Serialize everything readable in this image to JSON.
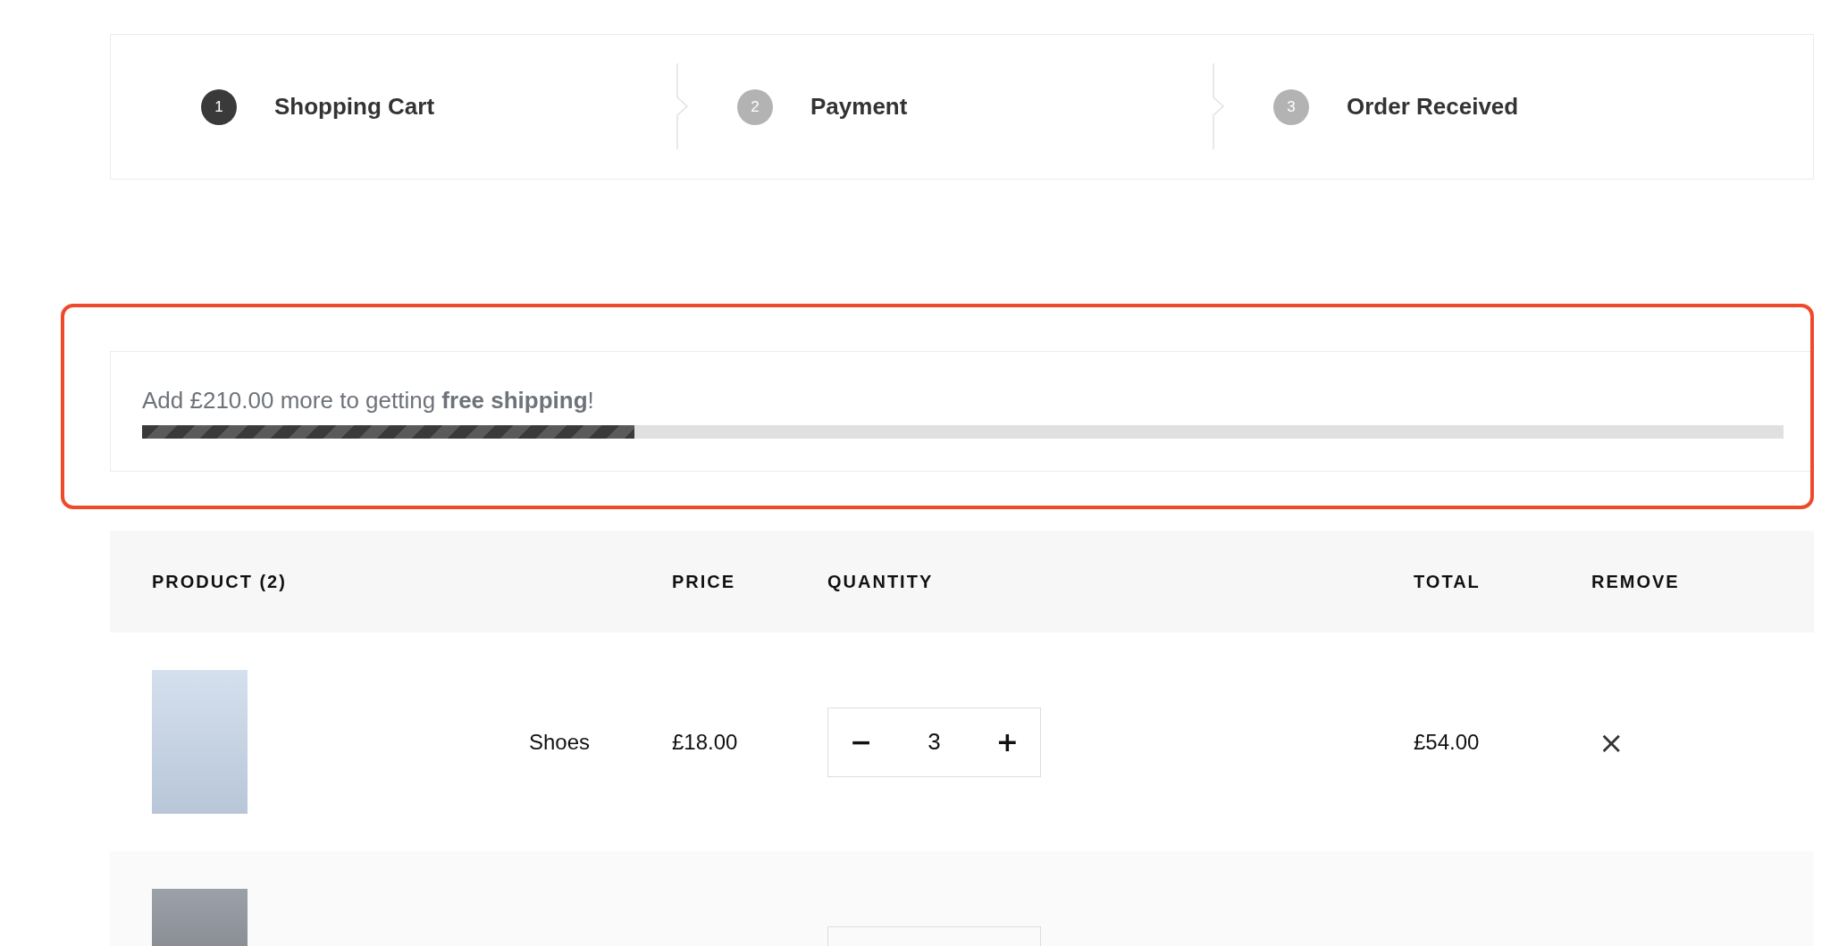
{
  "steps": [
    {
      "number": "1",
      "label": "Shopping Cart",
      "selected": true
    },
    {
      "number": "2",
      "label": "Payment",
      "selected": false
    },
    {
      "number": "3",
      "label": "Order Received",
      "selected": false
    }
  ],
  "shipping": {
    "message": "Add £210.00 more to getting **free shipping**!",
    "level": 0.3
  },
  "table": {
    "columns": [
      "PRODUCT (2)",
      "PRICE",
      "QUANTITY",
      "TOTAL",
      "REMOVE"
    ],
    "rows": [
      {
        "name": "Shoes",
        "price": "£18.00",
        "quantity": "3",
        "total": "£54.00",
        "minus": "−",
        "plus": "+",
        "remove": "×"
      },
      {}
    ]
  }
}
